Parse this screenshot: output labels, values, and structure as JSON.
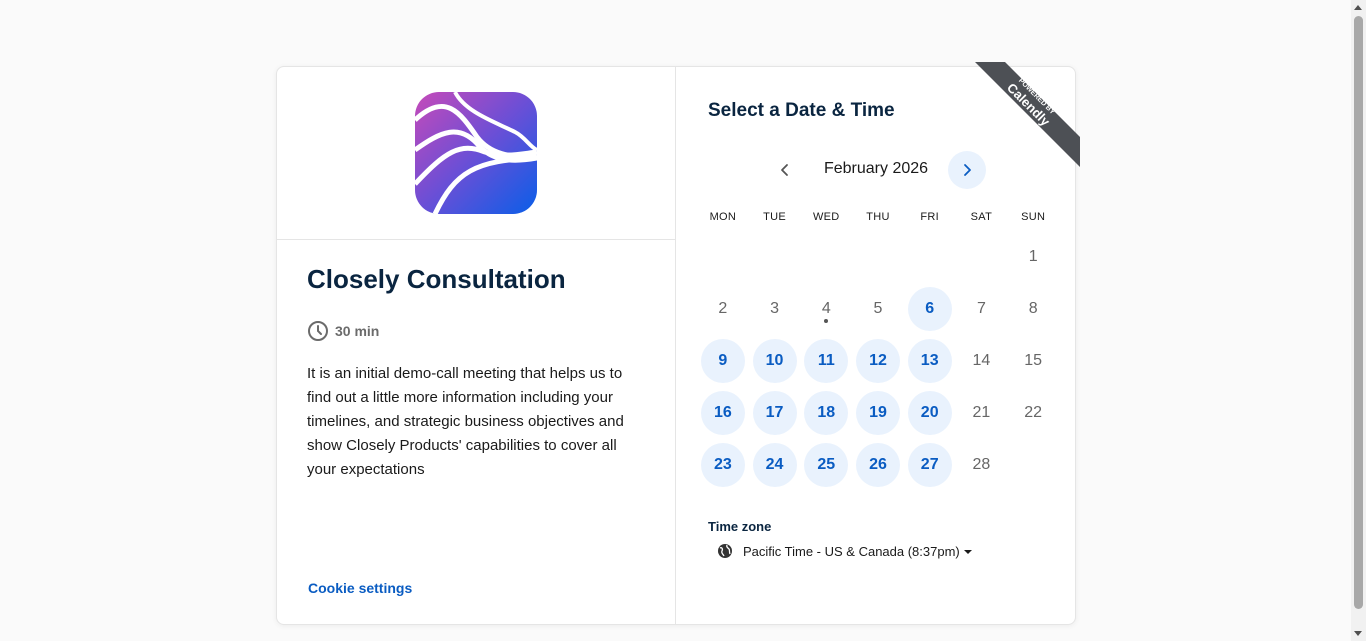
{
  "event": {
    "title": "Closely Consultation",
    "duration": "30 min",
    "description": "It is an initial demo-call meeting that helps us to find out a little more information including your timelines, and strategic business objectives and show Closely Products' capabilities to cover all your expectations",
    "cookie_settings": "Cookie settings"
  },
  "calendar": {
    "heading": "Select a Date & Time",
    "month_label": "February 2026",
    "weekdays": [
      "MON",
      "TUE",
      "WED",
      "THU",
      "FRI",
      "SAT",
      "SUN"
    ],
    "days": [
      {
        "d": "",
        "available": false
      },
      {
        "d": "",
        "available": false
      },
      {
        "d": "",
        "available": false
      },
      {
        "d": "",
        "available": false
      },
      {
        "d": "",
        "available": false
      },
      {
        "d": "",
        "available": false
      },
      {
        "d": "1",
        "available": false
      },
      {
        "d": "2",
        "available": false
      },
      {
        "d": "3",
        "available": false
      },
      {
        "d": "4",
        "available": false,
        "today": true
      },
      {
        "d": "5",
        "available": false
      },
      {
        "d": "6",
        "available": true
      },
      {
        "d": "7",
        "available": false
      },
      {
        "d": "8",
        "available": false
      },
      {
        "d": "9",
        "available": true
      },
      {
        "d": "10",
        "available": true
      },
      {
        "d": "11",
        "available": true
      },
      {
        "d": "12",
        "available": true
      },
      {
        "d": "13",
        "available": true
      },
      {
        "d": "14",
        "available": false
      },
      {
        "d": "15",
        "available": false
      },
      {
        "d": "16",
        "available": true
      },
      {
        "d": "17",
        "available": true
      },
      {
        "d": "18",
        "available": true
      },
      {
        "d": "19",
        "available": true
      },
      {
        "d": "20",
        "available": true
      },
      {
        "d": "21",
        "available": false
      },
      {
        "d": "22",
        "available": false
      },
      {
        "d": "23",
        "available": true
      },
      {
        "d": "24",
        "available": true
      },
      {
        "d": "25",
        "available": true
      },
      {
        "d": "26",
        "available": true
      },
      {
        "d": "27",
        "available": true
      },
      {
        "d": "28",
        "available": false
      }
    ]
  },
  "timezone": {
    "label": "Time zone",
    "value": "Pacific Time - US & Canada (8:37pm)"
  },
  "ribbon": {
    "line1": "POWERED BY",
    "line2": "Calendly"
  },
  "colors": {
    "accent": "#0a5cc2",
    "available_bg": "#e9f2fd",
    "ribbon_bg": "#4d5055"
  },
  "icons": [
    "clock-icon",
    "chevron-left-icon",
    "chevron-right-icon",
    "globe-icon",
    "caret-down-icon"
  ]
}
